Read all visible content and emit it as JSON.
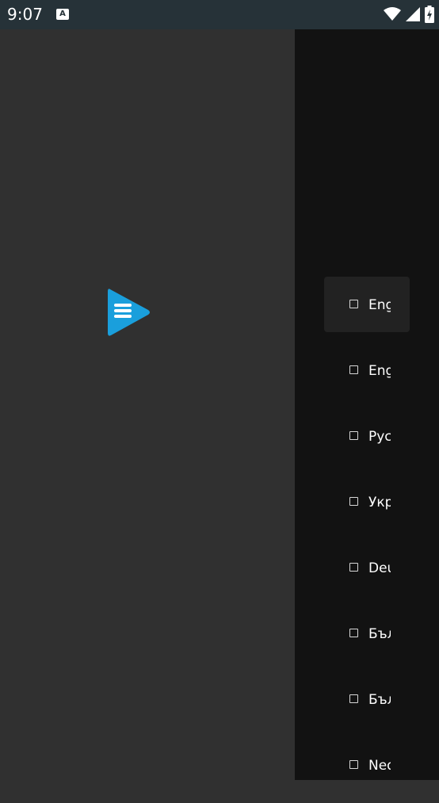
{
  "status_bar": {
    "time": "9:07",
    "notification_icon": "a-notification-icon",
    "icons": [
      "wifi-icon",
      "signal-icon",
      "battery-charging-icon"
    ]
  },
  "main": {
    "logo": "play-menu-logo-icon",
    "logo_color": "#1a9fdc"
  },
  "languages": {
    "items": [
      {
        "label": "English",
        "checked": false,
        "focused": true
      },
      {
        "label": "English",
        "checked": false,
        "focused": false
      },
      {
        "label": "Русский",
        "checked": false,
        "focused": false
      },
      {
        "label": "Українська",
        "checked": false,
        "focused": false
      },
      {
        "label": "Deutsch",
        "checked": false,
        "focused": false
      },
      {
        "label": "Български",
        "checked": false,
        "focused": false
      },
      {
        "label": "Български",
        "checked": false,
        "focused": false
      },
      {
        "label": "Nederlands",
        "checked": false,
        "focused": false
      }
    ]
  }
}
